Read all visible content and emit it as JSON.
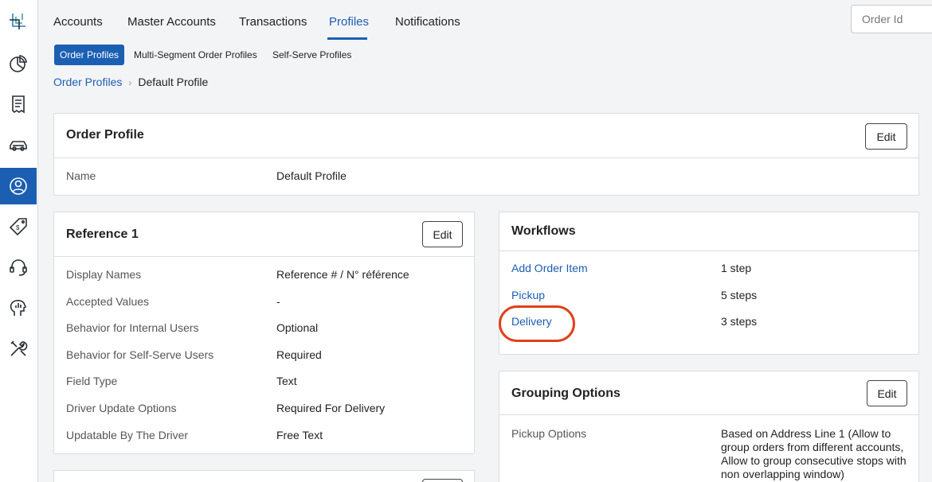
{
  "sidebar": {
    "items": [
      {
        "icon": "app-logo-icon"
      },
      {
        "icon": "pie-chart-icon"
      },
      {
        "icon": "receipt-icon"
      },
      {
        "icon": "car-icon"
      },
      {
        "icon": "user-circle-icon",
        "active": true
      },
      {
        "icon": "price-tag-icon"
      },
      {
        "icon": "headset-icon"
      },
      {
        "icon": "analytics-head-icon"
      },
      {
        "icon": "tools-icon"
      }
    ]
  },
  "topnav": {
    "tabs": [
      "Accounts",
      "Master Accounts",
      "Transactions",
      "Profiles",
      "Notifications"
    ],
    "active": "Profiles",
    "search_placeholder": "Order Id"
  },
  "subtabs": [
    "Order Profiles",
    "Multi-Segment Order Profiles",
    "Self-Serve Profiles"
  ],
  "breadcrumb": {
    "parent": "Order Profiles",
    "current": "Default Profile"
  },
  "order_profile": {
    "title": "Order Profile",
    "edit": "Edit",
    "rows": [
      {
        "label": "Name",
        "value": "Default Profile"
      }
    ]
  },
  "reference1": {
    "title": "Reference 1",
    "edit": "Edit",
    "rows": [
      {
        "label": "Display Names",
        "value": "Reference # / N° référence"
      },
      {
        "label": "Accepted Values",
        "value": "-"
      },
      {
        "label": "Behavior for Internal Users",
        "value": "Optional"
      },
      {
        "label": "Behavior for Self-Serve Users",
        "value": "Required"
      },
      {
        "label": "Field Type",
        "value": "Text"
      },
      {
        "label": "Driver Update Options",
        "value": "Required For Delivery"
      },
      {
        "label": "Updatable By The Driver",
        "value": "Free Text"
      }
    ]
  },
  "workflows": {
    "title": "Workflows",
    "rows": [
      {
        "name": "Add Order Item",
        "steps": "1 step"
      },
      {
        "name": "Pickup",
        "steps": "5 steps"
      },
      {
        "name": "Delivery",
        "steps": "3 steps"
      }
    ]
  },
  "grouping": {
    "title": "Grouping Options",
    "edit": "Edit",
    "rows": [
      {
        "label": "Pickup Options",
        "value": "Based on Address Line 1 (Allow to group orders from different accounts, Allow to group consecutive stops with non overlapping window)"
      }
    ]
  },
  "colors": {
    "accent": "#1b5fb3",
    "annotation": "#e0401a"
  }
}
